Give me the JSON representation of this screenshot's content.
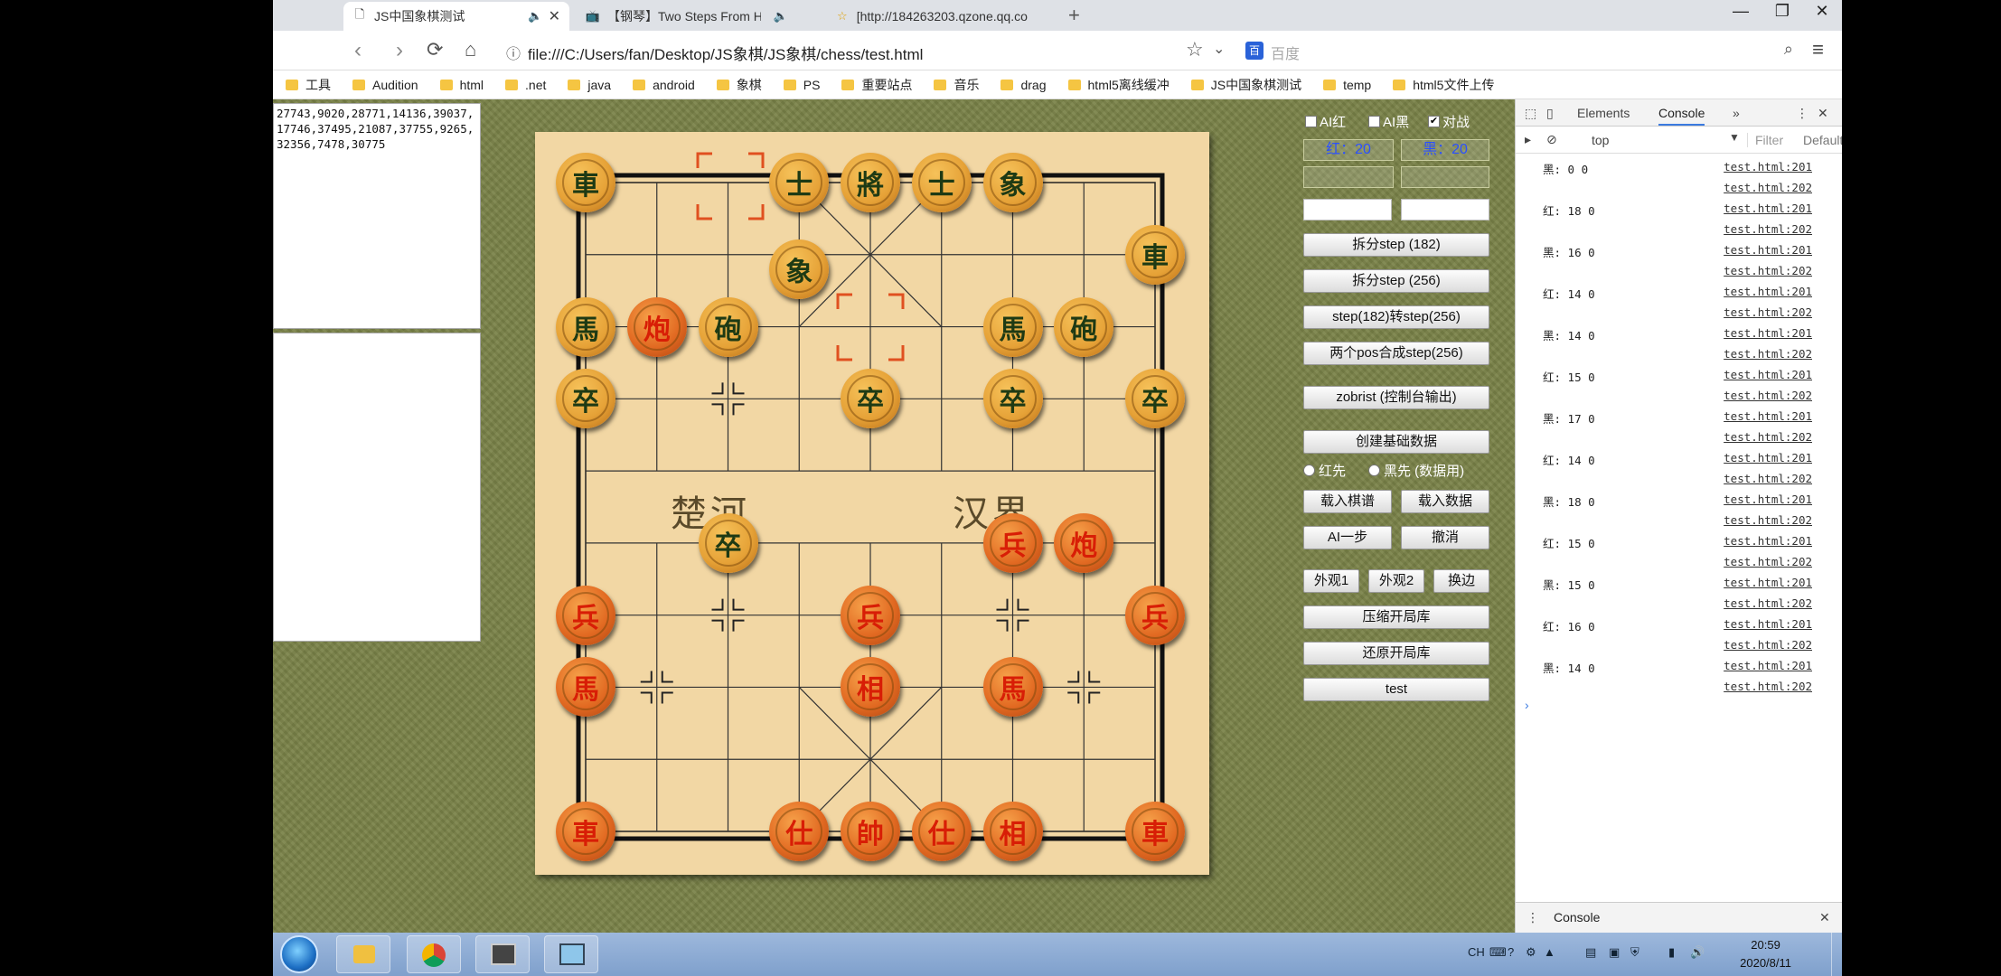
{
  "browser": {
    "tabs": [
      {
        "title": "JS中国象棋测试",
        "icon": "page-icon"
      },
      {
        "title": "【钢琴】Two Steps From He",
        "icon": "bilibili-icon"
      },
      {
        "title": "[http://184263203.qzone.qq.co",
        "icon": "star-icon"
      }
    ],
    "url": "file:///C:/Users/fan/Desktop/JS象棋/JS象棋/chess/test.html",
    "search_placeholder": "百度",
    "bookmarks": [
      "工具",
      "Audition",
      "html",
      ".net",
      "java",
      "android",
      "象棋",
      "PS",
      "重要站点",
      "音乐",
      "drag",
      "html5离线缓冲",
      "JS中国象棋测试",
      "temp",
      "html5文件上传"
    ]
  },
  "textarea1": "27743,9020,28771,14136,39037,17746,37495,21087,37755,9265,32356,7478,30775",
  "board": {
    "river_left": "楚河",
    "river_right": "汉界",
    "pieces": [
      {
        "c": "車",
        "side": "black",
        "col": 0,
        "row": 0
      },
      {
        "c": "士",
        "side": "black",
        "col": 3,
        "row": 0
      },
      {
        "c": "將",
        "side": "black",
        "col": 4,
        "row": 0
      },
      {
        "c": "士",
        "side": "black",
        "col": 5,
        "row": 0
      },
      {
        "c": "象",
        "side": "black",
        "col": 6,
        "row": 0
      },
      {
        "c": "車",
        "side": "black",
        "col": 8,
        "row": 1
      },
      {
        "c": "象",
        "side": "black",
        "col": 3,
        "row": 1.2
      },
      {
        "c": "馬",
        "side": "black",
        "col": 0,
        "row": 2
      },
      {
        "c": "炮",
        "side": "red",
        "col": 1,
        "row": 2
      },
      {
        "c": "砲",
        "side": "black",
        "col": 2,
        "row": 2
      },
      {
        "c": "馬",
        "side": "black",
        "col": 6,
        "row": 2
      },
      {
        "c": "砲",
        "side": "black",
        "col": 7,
        "row": 2
      },
      {
        "c": "卒",
        "side": "black",
        "col": 0,
        "row": 3
      },
      {
        "c": "卒",
        "side": "black",
        "col": 4,
        "row": 3
      },
      {
        "c": "卒",
        "side": "black",
        "col": 6,
        "row": 3
      },
      {
        "c": "卒",
        "side": "black",
        "col": 8,
        "row": 3
      },
      {
        "c": "卒",
        "side": "black",
        "col": 2,
        "row": 5
      },
      {
        "c": "兵",
        "side": "red",
        "col": 6,
        "row": 5
      },
      {
        "c": "炮",
        "side": "red",
        "col": 7,
        "row": 5
      },
      {
        "c": "兵",
        "side": "red",
        "col": 0,
        "row": 6
      },
      {
        "c": "兵",
        "side": "red",
        "col": 4,
        "row": 6
      },
      {
        "c": "兵",
        "side": "red",
        "col": 8,
        "row": 6
      },
      {
        "c": "馬",
        "side": "red",
        "col": 0,
        "row": 7
      },
      {
        "c": "相",
        "side": "red",
        "col": 4,
        "row": 7
      },
      {
        "c": "馬",
        "side": "red",
        "col": 6,
        "row": 7
      },
      {
        "c": "車",
        "side": "red",
        "col": 0,
        "row": 9
      },
      {
        "c": "仕",
        "side": "red",
        "col": 3,
        "row": 9
      },
      {
        "c": "帥",
        "side": "red",
        "col": 4,
        "row": 9
      },
      {
        "c": "仕",
        "side": "red",
        "col": 5,
        "row": 9
      },
      {
        "c": "相",
        "side": "red",
        "col": 6,
        "row": 9
      },
      {
        "c": "車",
        "side": "red",
        "col": 8,
        "row": 9
      }
    ]
  },
  "controls": {
    "ai_red": "AI红",
    "ai_black": "AI黑",
    "duel": "对战",
    "red_time": "红：20",
    "black_time": "黑：20",
    "btn_split182": "拆分step (182)",
    "btn_split256": "拆分step (256)",
    "btn_convert": "step(182)转step(256)",
    "btn_compose": "两个pos合成step(256)",
    "btn_zobrist": "zobrist (控制台输出)",
    "btn_create": "创建基础数据",
    "radio_red": "红先",
    "radio_black": "黑先 (数据用)",
    "btn_load_record": "载入棋谱",
    "btn_load_data": "载入数据",
    "btn_ai_step": "AI一步",
    "btn_undo": "撤消",
    "btn_look1": "外观1",
    "btn_look2": "外观2",
    "btn_swap": "换边",
    "btn_compress": "压缩开局库",
    "btn_restore": "还原开局库",
    "btn_test": "test"
  },
  "devtools": {
    "tab_elements": "Elements",
    "tab_console": "Console",
    "context": "top",
    "filter": "Filter",
    "levels": "Default",
    "drawer_tab": "Console",
    "log": [
      {
        "msg": "黑: 0 0",
        "src": "test.html:201"
      },
      {
        "msg": "",
        "src": "test.html:202"
      },
      {
        "msg": "红: 18 0",
        "src": "test.html:201"
      },
      {
        "msg": "",
        "src": "test.html:202"
      },
      {
        "msg": "黑: 16 0",
        "src": "test.html:201"
      },
      {
        "msg": "",
        "src": "test.html:202"
      },
      {
        "msg": "红: 14 0",
        "src": "test.html:201"
      },
      {
        "msg": "",
        "src": "test.html:202"
      },
      {
        "msg": "黑: 14 0",
        "src": "test.html:201"
      },
      {
        "msg": "",
        "src": "test.html:202"
      },
      {
        "msg": "红: 15 0",
        "src": "test.html:201"
      },
      {
        "msg": "",
        "src": "test.html:202"
      },
      {
        "msg": "黑: 17 0",
        "src": "test.html:201"
      },
      {
        "msg": "",
        "src": "test.html:202"
      },
      {
        "msg": "红: 14 0",
        "src": "test.html:201"
      },
      {
        "msg": "",
        "src": "test.html:202"
      },
      {
        "msg": "黑: 18 0",
        "src": "test.html:201"
      },
      {
        "msg": "",
        "src": "test.html:202"
      },
      {
        "msg": "红: 15 0",
        "src": "test.html:201"
      },
      {
        "msg": "",
        "src": "test.html:202"
      },
      {
        "msg": "黑: 15 0",
        "src": "test.html:201"
      },
      {
        "msg": "",
        "src": "test.html:202"
      },
      {
        "msg": "红: 16 0",
        "src": "test.html:201"
      },
      {
        "msg": "",
        "src": "test.html:202"
      },
      {
        "msg": "黑: 14 0",
        "src": "test.html:201"
      },
      {
        "msg": "",
        "src": "test.html:202"
      }
    ]
  },
  "taskbar": {
    "ime": "CH",
    "time": "20:59",
    "date": "2020/8/11"
  }
}
